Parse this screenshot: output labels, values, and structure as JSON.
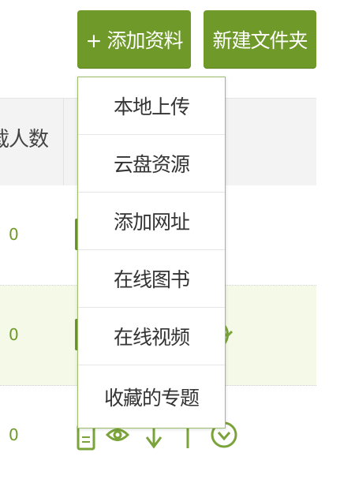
{
  "toolbar": {
    "add_material_label": "+ 添加资料",
    "new_folder_label": "新建文件夹"
  },
  "table": {
    "header_partial": "载人数",
    "rows": [
      {
        "count": "0"
      },
      {
        "count": "0"
      },
      {
        "count": "0"
      }
    ]
  },
  "dropdown": {
    "items": [
      "本地上传",
      "云盘资源",
      "添加网址",
      "在线图书",
      "在线视频",
      "收藏的专题"
    ]
  },
  "colors": {
    "accent": "#6f9a2a",
    "row_highlight": "#f4f9e8",
    "header_bg": "#f3f3f3"
  },
  "icons": [
    "document-icon",
    "eye-icon",
    "arrow-down-icon",
    "arrow-up-icon",
    "chevron-down-circle-icon"
  ]
}
